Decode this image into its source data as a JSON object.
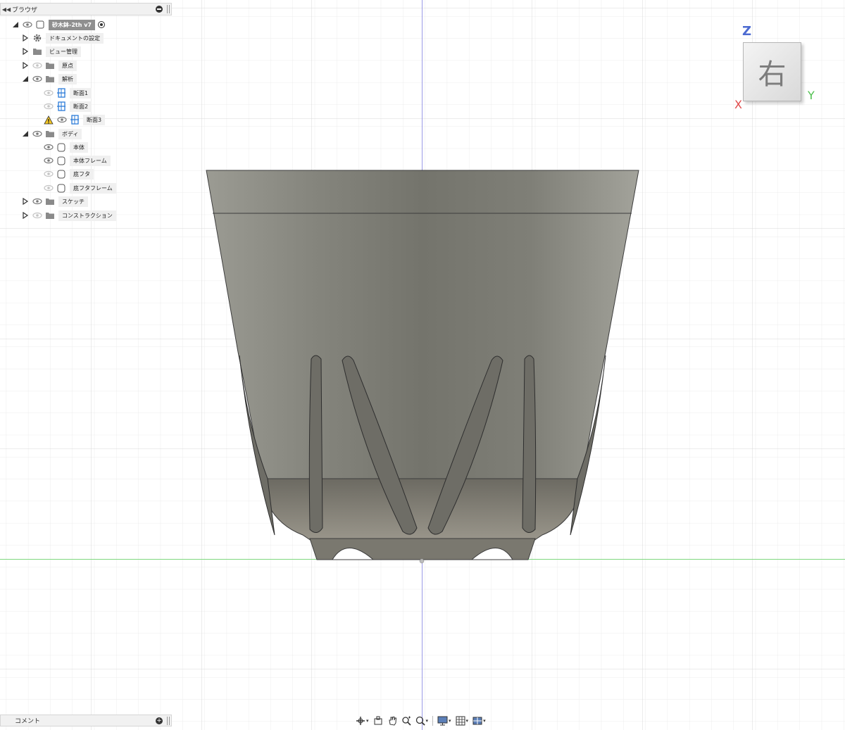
{
  "browser": {
    "title": "ブラウザ",
    "items": [
      {
        "label": "砂木鉢-2th v7",
        "level": 0,
        "expanded": true,
        "type": "component"
      },
      {
        "label": "ドキュメントの設定",
        "level": 1,
        "expanded": false,
        "type": "settings"
      },
      {
        "label": "ビュー管理",
        "level": 1,
        "expanded": false,
        "type": "folder"
      },
      {
        "label": "原点",
        "level": 1,
        "expanded": false,
        "type": "folder"
      },
      {
        "label": "解析",
        "level": 1,
        "expanded": true,
        "type": "folder"
      },
      {
        "label": "断面1",
        "level": 2,
        "type": "section"
      },
      {
        "label": "断面2",
        "level": 2,
        "type": "section"
      },
      {
        "label": "断面3",
        "level": 2,
        "type": "section",
        "warning": true
      },
      {
        "label": "ボディ",
        "level": 1,
        "expanded": true,
        "type": "folder"
      },
      {
        "label": "本体",
        "level": 2,
        "type": "body"
      },
      {
        "label": "本体フレーム",
        "level": 2,
        "type": "body"
      },
      {
        "label": "底フタ",
        "level": 2,
        "type": "body"
      },
      {
        "label": "底フタフレーム",
        "level": 2,
        "type": "body"
      },
      {
        "label": "スケッチ",
        "level": 1,
        "expanded": false,
        "type": "folder"
      },
      {
        "label": "コンストラクション",
        "level": 1,
        "expanded": false,
        "type": "folder"
      }
    ]
  },
  "comments": {
    "title": "コメント"
  },
  "viewcube": {
    "face_label": "右",
    "axis_z": "Z",
    "axis_y": "Y",
    "axis_x": "X",
    "colors": {
      "z": "#4d6bd1",
      "y": "#4fc04f",
      "x": "#e04a4a"
    }
  },
  "nav_toolbar": {
    "icons": [
      "orbit-icon",
      "look-at-icon",
      "pan-icon",
      "zoom-icon",
      "fit-icon",
      "display-settings-icon",
      "grid-icon",
      "viewports-icon"
    ]
  },
  "colors": {
    "grid": "#e3e3e3",
    "axis_vertical": "#8a8ae0",
    "axis_horizontal": "#7cd67c",
    "model": "#8d8d86"
  }
}
